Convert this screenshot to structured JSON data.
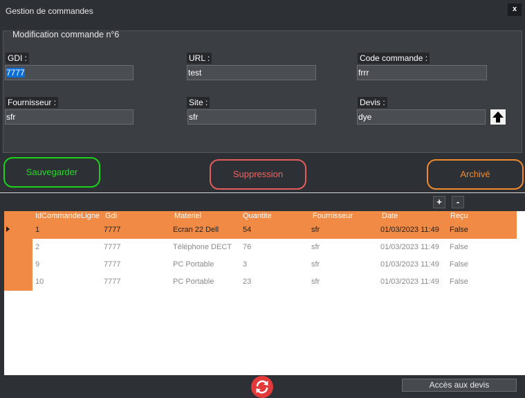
{
  "window": {
    "title": "Gestion de commandes",
    "close_label": "x"
  },
  "group": {
    "title": "Modification commande n°6"
  },
  "fields": {
    "gdi": {
      "label": "GDI :",
      "value": "7777"
    },
    "url": {
      "label": "URL :",
      "value": "test"
    },
    "code": {
      "label": "Code commande :",
      "value": "frrr"
    },
    "fournisseur": {
      "label": "Fournisseur :",
      "value": "sfr"
    },
    "site": {
      "label": "Site :",
      "value": "sfr"
    },
    "devis": {
      "label": "Devis :",
      "value": "dye"
    }
  },
  "buttons": {
    "save": "Sauvegarder",
    "delete": "Suppression",
    "archive": "Archivé",
    "add": "+",
    "remove": "-",
    "devis": "Accès aux devis"
  },
  "grid": {
    "columns": [
      "IdCommandeLigne",
      "Gdi",
      "Materiel",
      "Quantite",
      "Fournisseur",
      "Date",
      "Reçu"
    ],
    "rows": [
      [
        "1",
        "7777",
        "Ecran 22 Dell",
        "54",
        "sfr",
        "01/03/2023 11:49",
        "False"
      ],
      [
        "2",
        "7777",
        "Téléphone DECT",
        "76",
        "sfr",
        "01/03/2023 11:49",
        "False"
      ],
      [
        "9",
        "7777",
        "PC Portable",
        "3",
        "sfr",
        "01/03/2023 11:49",
        "False"
      ],
      [
        "10",
        "7777",
        "PC Portable",
        "23",
        "sfr",
        "01/03/2023 11:49",
        "False"
      ]
    ],
    "selected_row": 0
  },
  "colors": {
    "accent_orange": "#f08a45",
    "save_green": "#19d419",
    "delete_red": "#e65c5c",
    "archive_orange": "#f08a2c",
    "refresh_red": "#e23a3a"
  },
  "icons": {
    "upload": "arrow-up-icon",
    "refresh": "refresh-icon",
    "row_indicator": "row-pointer-icon"
  }
}
